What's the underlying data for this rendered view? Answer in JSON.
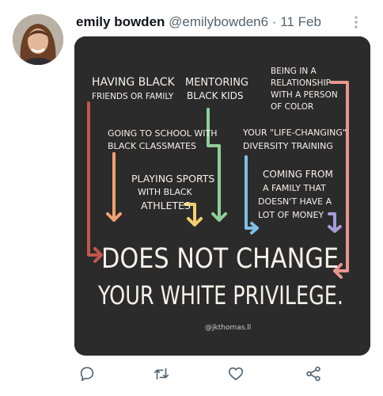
{
  "tweet": {
    "author_name": "emily bowden",
    "author_handle": "@emilybowden6",
    "separator": "·",
    "date": "11 Feb"
  },
  "image": {
    "items": {
      "black_friends_line1": "HAVING BLACK",
      "black_friends_line2": "FRIENDS OR FAMILY",
      "mentoring_line1": "MENTORING",
      "mentoring_line2": "BLACK KIDS",
      "relationship_line1": "BEING IN A",
      "relationship_line2": "RELATIONSHIP",
      "relationship_line3": "WITH A PERSON",
      "relationship_line4": "OF COLOR",
      "school_line1": "GOING TO SCHOOL WITH",
      "school_line2": "BLACK CLASSMATES",
      "training_line1": "YOUR \"LIFE-CHANGING\"",
      "training_line2": "DIVERSITY TRAINING",
      "sports_line1": "PLAYING SPORTS",
      "sports_line2": "WITH BLACK",
      "sports_line3": "ATHLETES",
      "money_line1": "COMING FROM",
      "money_line2": "A FAMILY THAT",
      "money_line3": "DOESN'T HAVE A",
      "money_line4": "LOT OF MONEY"
    },
    "headline_line1": "DOES NOT CHANGE",
    "headline_line2": "YOUR WHITE PRIVILEGE.",
    "credit": "@jkthomas.ll",
    "colors": {
      "background": "#2b2b2b",
      "text": "#f4f1ea",
      "arrow_red": "#c0584b",
      "arrow_green": "#8fce9a",
      "arrow_pink": "#e9968e",
      "arrow_orange": "#f0a070",
      "arrow_blue": "#7fbfe6",
      "arrow_yellow": "#f2d06b",
      "arrow_purple": "#a79ad6"
    }
  },
  "actions": {
    "reply_icon": "speech-bubble",
    "retweet_icon": "retweet-arrows",
    "like_icon": "heart",
    "share_icon": "share-nodes"
  }
}
